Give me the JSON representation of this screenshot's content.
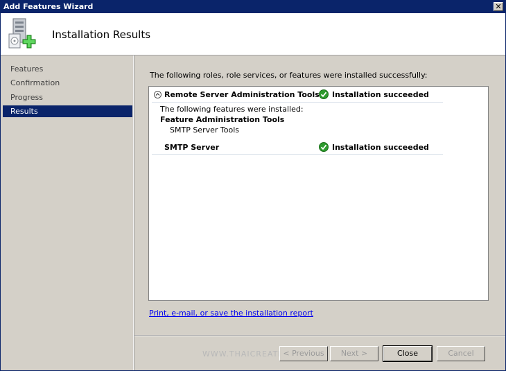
{
  "window": {
    "title": "Add Features Wizard"
  },
  "header": {
    "title": "Installation Results"
  },
  "sidebar": {
    "items": [
      {
        "label": "Features"
      },
      {
        "label": "Confirmation"
      },
      {
        "label": "Progress"
      },
      {
        "label": "Results"
      }
    ],
    "active": "Results"
  },
  "main": {
    "intro": "The following roles, role services, or features were installed successfully:",
    "results": [
      {
        "name": "Remote Server Administration Tools",
        "status": "Installation succeeded",
        "details_heading": "The following features were installed:",
        "group": "Feature Administration Tools",
        "sub_item": "SMTP Server Tools"
      },
      {
        "name": "SMTP Server",
        "status": "Installation succeeded"
      }
    ],
    "report_link": "Print, e-mail, or save the installation report"
  },
  "watermark": "WWW.THAICREATE.COM",
  "buttons": {
    "previous": "< Previous",
    "next": "Next >",
    "close": "Close",
    "cancel": "Cancel"
  },
  "colors": {
    "titlebar": "#0a246a",
    "selection": "#0a246a",
    "success": "#2e9b2e",
    "link": "#0000ee"
  }
}
